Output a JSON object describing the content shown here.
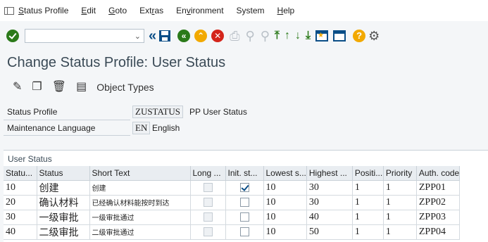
{
  "menu": {
    "items": [
      "Status Profile",
      "Edit",
      "Goto",
      "Extras",
      "Environment",
      "System",
      "Help"
    ]
  },
  "toolbar": {
    "command_value": "",
    "icons": [
      "enter-icon",
      "command-field",
      "back-double-icon",
      "save-icon",
      "back-icon",
      "exit-icon",
      "cancel-icon",
      "print-icon",
      "find-icon",
      "find-next-icon",
      "first-page-icon",
      "previous-page-icon",
      "next-page-icon",
      "last-page-icon",
      "create-session-icon",
      "shortcut-icon",
      "help-icon",
      "customize-icon"
    ]
  },
  "page_title": "Change Status Profile: User Status",
  "app_toolbar": {
    "object_types_label": "Object Types"
  },
  "header": {
    "status_profile_label": "Status Profile",
    "status_profile_value": "ZUSTATUS",
    "status_profile_desc": "PP User Status",
    "language_label": "Maintenance Language",
    "language_value": "EN",
    "language_desc": "English"
  },
  "table": {
    "title": "User Status",
    "columns": [
      "Statu...",
      "Status",
      "Short Text",
      "Long ...",
      "Init. st...",
      "Lowest s...",
      "Highest ...",
      "Positi...",
      "Priority",
      "Auth. code"
    ],
    "rows": [
      {
        "num": "10",
        "status": "创建",
        "short": "创建",
        "long": false,
        "init": true,
        "lowest": "10",
        "highest": "30",
        "pos": "1",
        "prio": "1",
        "auth": "ZPP01"
      },
      {
        "num": "20",
        "status": "确认材料",
        "short": "已经确认材料能按时到达",
        "long": false,
        "init": false,
        "lowest": "10",
        "highest": "30",
        "pos": "1",
        "prio": "1",
        "auth": "ZPP02"
      },
      {
        "num": "30",
        "status": "一级审批",
        "short": "一级审批通过",
        "long": false,
        "init": false,
        "lowest": "10",
        "highest": "40",
        "pos": "1",
        "prio": "1",
        "auth": "ZPP03"
      },
      {
        "num": "40",
        "status": "二级审批",
        "short": "二级审批通过",
        "long": false,
        "init": false,
        "lowest": "10",
        "highest": "50",
        "pos": "1",
        "prio": "1",
        "auth": "ZPP04"
      }
    ]
  },
  "colors": {
    "sap_blue": "#0a4e87",
    "green": "#2b7a1a",
    "orange": "#f2a900",
    "red": "#d4251b"
  }
}
